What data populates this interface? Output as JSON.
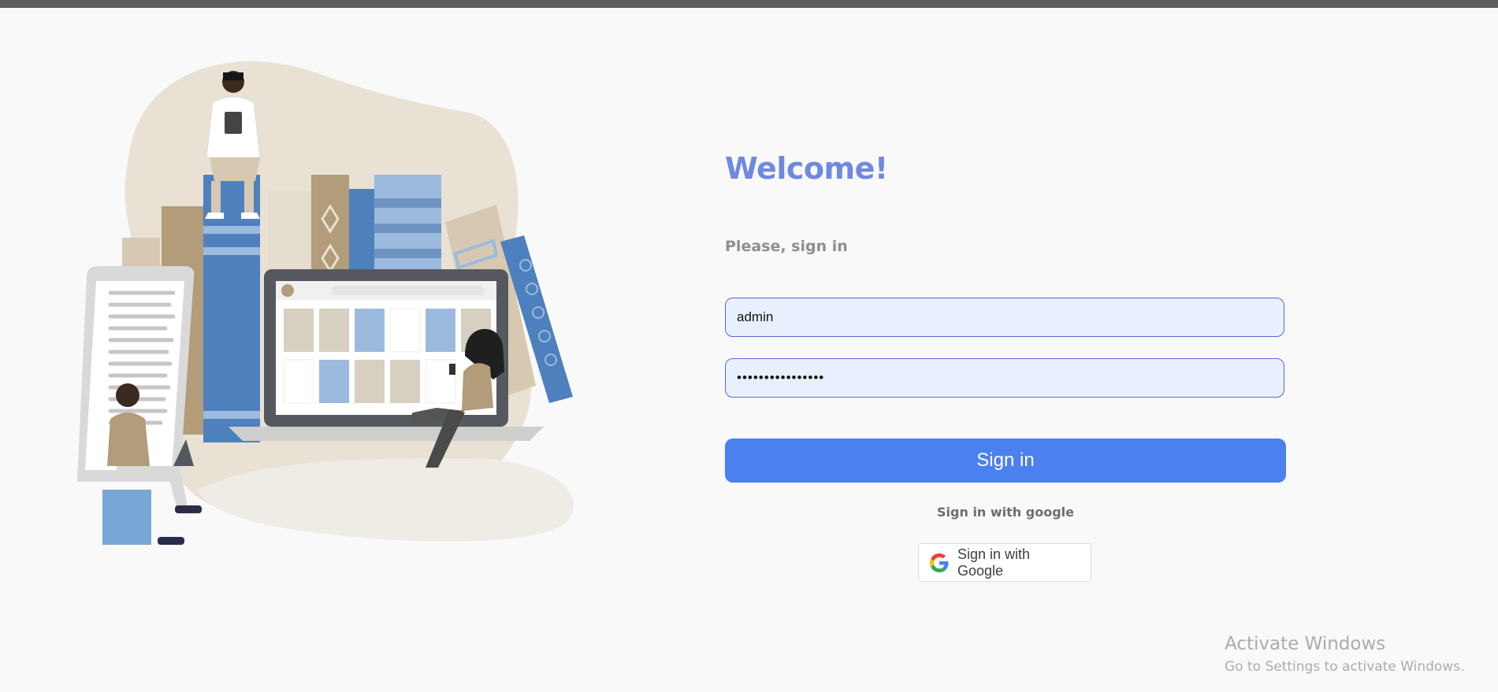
{
  "login": {
    "heading": "Welcome!",
    "subheading": "Please, sign in",
    "username_value": "admin",
    "password_value": "••••••••••••••••",
    "submit_label": "Sign in",
    "google_caption": "Sign in with google",
    "google_button_label": "Sign in with Google"
  },
  "watermark": {
    "line1": "Activate Windows",
    "line2": "Go to Settings to activate Windows."
  },
  "colors": {
    "accent": "#4a80f0",
    "heading": "#6f89e0",
    "field_bg": "#e8f0fe",
    "field_border": "#5b67d6"
  },
  "icons": {
    "google": "google-g-icon",
    "illustration": "reading-people-books-illustration"
  }
}
